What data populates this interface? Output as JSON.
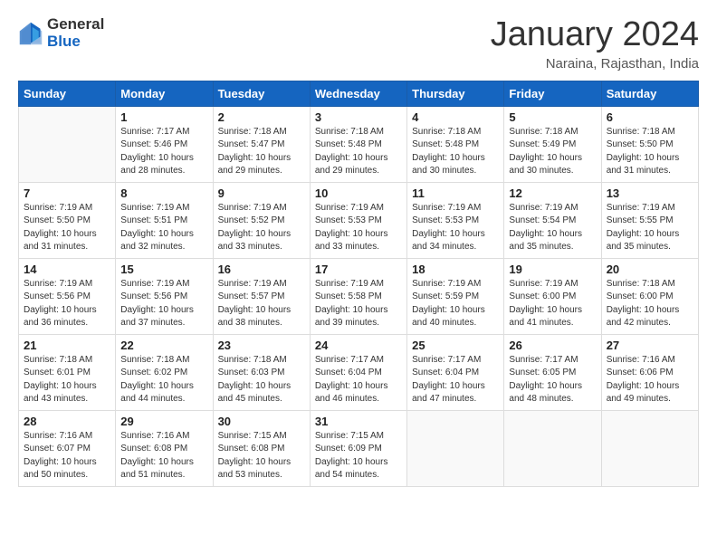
{
  "header": {
    "logo_general": "General",
    "logo_blue": "Blue",
    "title": "January 2024",
    "subtitle": "Naraina, Rajasthan, India"
  },
  "days_of_week": [
    "Sunday",
    "Monday",
    "Tuesday",
    "Wednesday",
    "Thursday",
    "Friday",
    "Saturday"
  ],
  "weeks": [
    [
      {
        "day": "",
        "info": ""
      },
      {
        "day": "1",
        "info": "Sunrise: 7:17 AM\nSunset: 5:46 PM\nDaylight: 10 hours\nand 28 minutes."
      },
      {
        "day": "2",
        "info": "Sunrise: 7:18 AM\nSunset: 5:47 PM\nDaylight: 10 hours\nand 29 minutes."
      },
      {
        "day": "3",
        "info": "Sunrise: 7:18 AM\nSunset: 5:48 PM\nDaylight: 10 hours\nand 29 minutes."
      },
      {
        "day": "4",
        "info": "Sunrise: 7:18 AM\nSunset: 5:48 PM\nDaylight: 10 hours\nand 30 minutes."
      },
      {
        "day": "5",
        "info": "Sunrise: 7:18 AM\nSunset: 5:49 PM\nDaylight: 10 hours\nand 30 minutes."
      },
      {
        "day": "6",
        "info": "Sunrise: 7:18 AM\nSunset: 5:50 PM\nDaylight: 10 hours\nand 31 minutes."
      }
    ],
    [
      {
        "day": "7",
        "info": "Sunrise: 7:19 AM\nSunset: 5:50 PM\nDaylight: 10 hours\nand 31 minutes."
      },
      {
        "day": "8",
        "info": "Sunrise: 7:19 AM\nSunset: 5:51 PM\nDaylight: 10 hours\nand 32 minutes."
      },
      {
        "day": "9",
        "info": "Sunrise: 7:19 AM\nSunset: 5:52 PM\nDaylight: 10 hours\nand 33 minutes."
      },
      {
        "day": "10",
        "info": "Sunrise: 7:19 AM\nSunset: 5:53 PM\nDaylight: 10 hours\nand 33 minutes."
      },
      {
        "day": "11",
        "info": "Sunrise: 7:19 AM\nSunset: 5:53 PM\nDaylight: 10 hours\nand 34 minutes."
      },
      {
        "day": "12",
        "info": "Sunrise: 7:19 AM\nSunset: 5:54 PM\nDaylight: 10 hours\nand 35 minutes."
      },
      {
        "day": "13",
        "info": "Sunrise: 7:19 AM\nSunset: 5:55 PM\nDaylight: 10 hours\nand 35 minutes."
      }
    ],
    [
      {
        "day": "14",
        "info": "Sunrise: 7:19 AM\nSunset: 5:56 PM\nDaylight: 10 hours\nand 36 minutes."
      },
      {
        "day": "15",
        "info": "Sunrise: 7:19 AM\nSunset: 5:56 PM\nDaylight: 10 hours\nand 37 minutes."
      },
      {
        "day": "16",
        "info": "Sunrise: 7:19 AM\nSunset: 5:57 PM\nDaylight: 10 hours\nand 38 minutes."
      },
      {
        "day": "17",
        "info": "Sunrise: 7:19 AM\nSunset: 5:58 PM\nDaylight: 10 hours\nand 39 minutes."
      },
      {
        "day": "18",
        "info": "Sunrise: 7:19 AM\nSunset: 5:59 PM\nDaylight: 10 hours\nand 40 minutes."
      },
      {
        "day": "19",
        "info": "Sunrise: 7:19 AM\nSunset: 6:00 PM\nDaylight: 10 hours\nand 41 minutes."
      },
      {
        "day": "20",
        "info": "Sunrise: 7:18 AM\nSunset: 6:00 PM\nDaylight: 10 hours\nand 42 minutes."
      }
    ],
    [
      {
        "day": "21",
        "info": "Sunrise: 7:18 AM\nSunset: 6:01 PM\nDaylight: 10 hours\nand 43 minutes."
      },
      {
        "day": "22",
        "info": "Sunrise: 7:18 AM\nSunset: 6:02 PM\nDaylight: 10 hours\nand 44 minutes."
      },
      {
        "day": "23",
        "info": "Sunrise: 7:18 AM\nSunset: 6:03 PM\nDaylight: 10 hours\nand 45 minutes."
      },
      {
        "day": "24",
        "info": "Sunrise: 7:17 AM\nSunset: 6:04 PM\nDaylight: 10 hours\nand 46 minutes."
      },
      {
        "day": "25",
        "info": "Sunrise: 7:17 AM\nSunset: 6:04 PM\nDaylight: 10 hours\nand 47 minutes."
      },
      {
        "day": "26",
        "info": "Sunrise: 7:17 AM\nSunset: 6:05 PM\nDaylight: 10 hours\nand 48 minutes."
      },
      {
        "day": "27",
        "info": "Sunrise: 7:16 AM\nSunset: 6:06 PM\nDaylight: 10 hours\nand 49 minutes."
      }
    ],
    [
      {
        "day": "28",
        "info": "Sunrise: 7:16 AM\nSunset: 6:07 PM\nDaylight: 10 hours\nand 50 minutes."
      },
      {
        "day": "29",
        "info": "Sunrise: 7:16 AM\nSunset: 6:08 PM\nDaylight: 10 hours\nand 51 minutes."
      },
      {
        "day": "30",
        "info": "Sunrise: 7:15 AM\nSunset: 6:08 PM\nDaylight: 10 hours\nand 53 minutes."
      },
      {
        "day": "31",
        "info": "Sunrise: 7:15 AM\nSunset: 6:09 PM\nDaylight: 10 hours\nand 54 minutes."
      },
      {
        "day": "",
        "info": ""
      },
      {
        "day": "",
        "info": ""
      },
      {
        "day": "",
        "info": ""
      }
    ]
  ]
}
